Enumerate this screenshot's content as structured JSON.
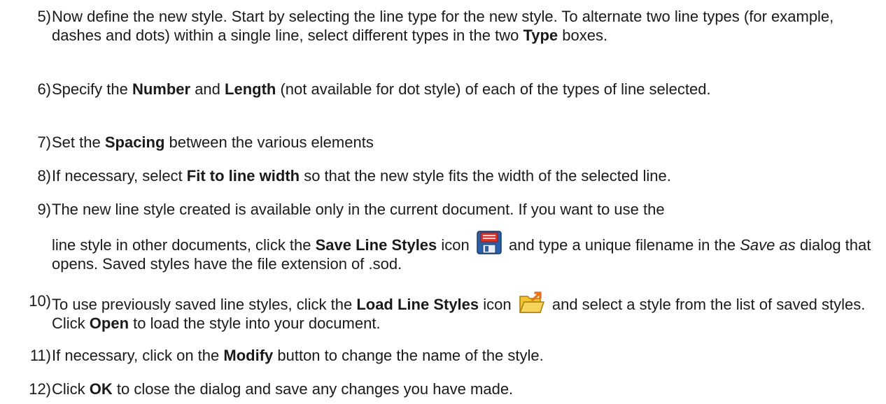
{
  "steps": [
    {
      "number": "5)",
      "parts": [
        "Now define the new style. Start by selecting the line type for the new style. To alternate two line types (for example, dashes and dots) within a single line, select different types in the two ",
        "Type",
        " boxes."
      ]
    },
    {
      "number": "6)",
      "parts": [
        "Specify the ",
        "Number",
        " and ",
        "Length",
        " (not available for dot style) of each of the types of line selected."
      ]
    },
    {
      "number": "7)",
      "parts": [
        "Set the ",
        "Spacing",
        " between the various elements"
      ]
    },
    {
      "number": "8)",
      "parts": [
        "If necessary, select ",
        "Fit to line width",
        " so that the new style fits the width of the selected line."
      ]
    },
    {
      "number": "9)",
      "parts": [
        "The new line style created is available only in the current document. If you want to use the",
        "line style in other documents, click the ",
        "Save Line Styles",
        " icon ",
        " and type a unique filename in the ",
        "Save as",
        " dialog that opens. Saved styles have the file extension of .sod."
      ],
      "icon": "save-line-styles-icon"
    },
    {
      "number": "10)",
      "parts": [
        "To use previously saved line styles, click the ",
        "Load Line Styles",
        " icon ",
        " and select a style from the list of saved styles. Click ",
        "Open",
        " to load the style into your document."
      ],
      "icon": "load-line-styles-icon"
    },
    {
      "number": "11)",
      "parts": [
        "If necessary, click on the ",
        "Modify",
        " button to change the name of the style."
      ]
    },
    {
      "number": "12)",
      "parts": [
        "Click ",
        "OK",
        " to close the dialog and save any changes you have made."
      ]
    }
  ],
  "colors": {
    "text": "#1a1a1a",
    "save_icon_blue": "#2c5fa8",
    "save_icon_red": "#d9342b",
    "load_icon_yellow": "#f2c230",
    "load_icon_orange": "#e8731c"
  }
}
